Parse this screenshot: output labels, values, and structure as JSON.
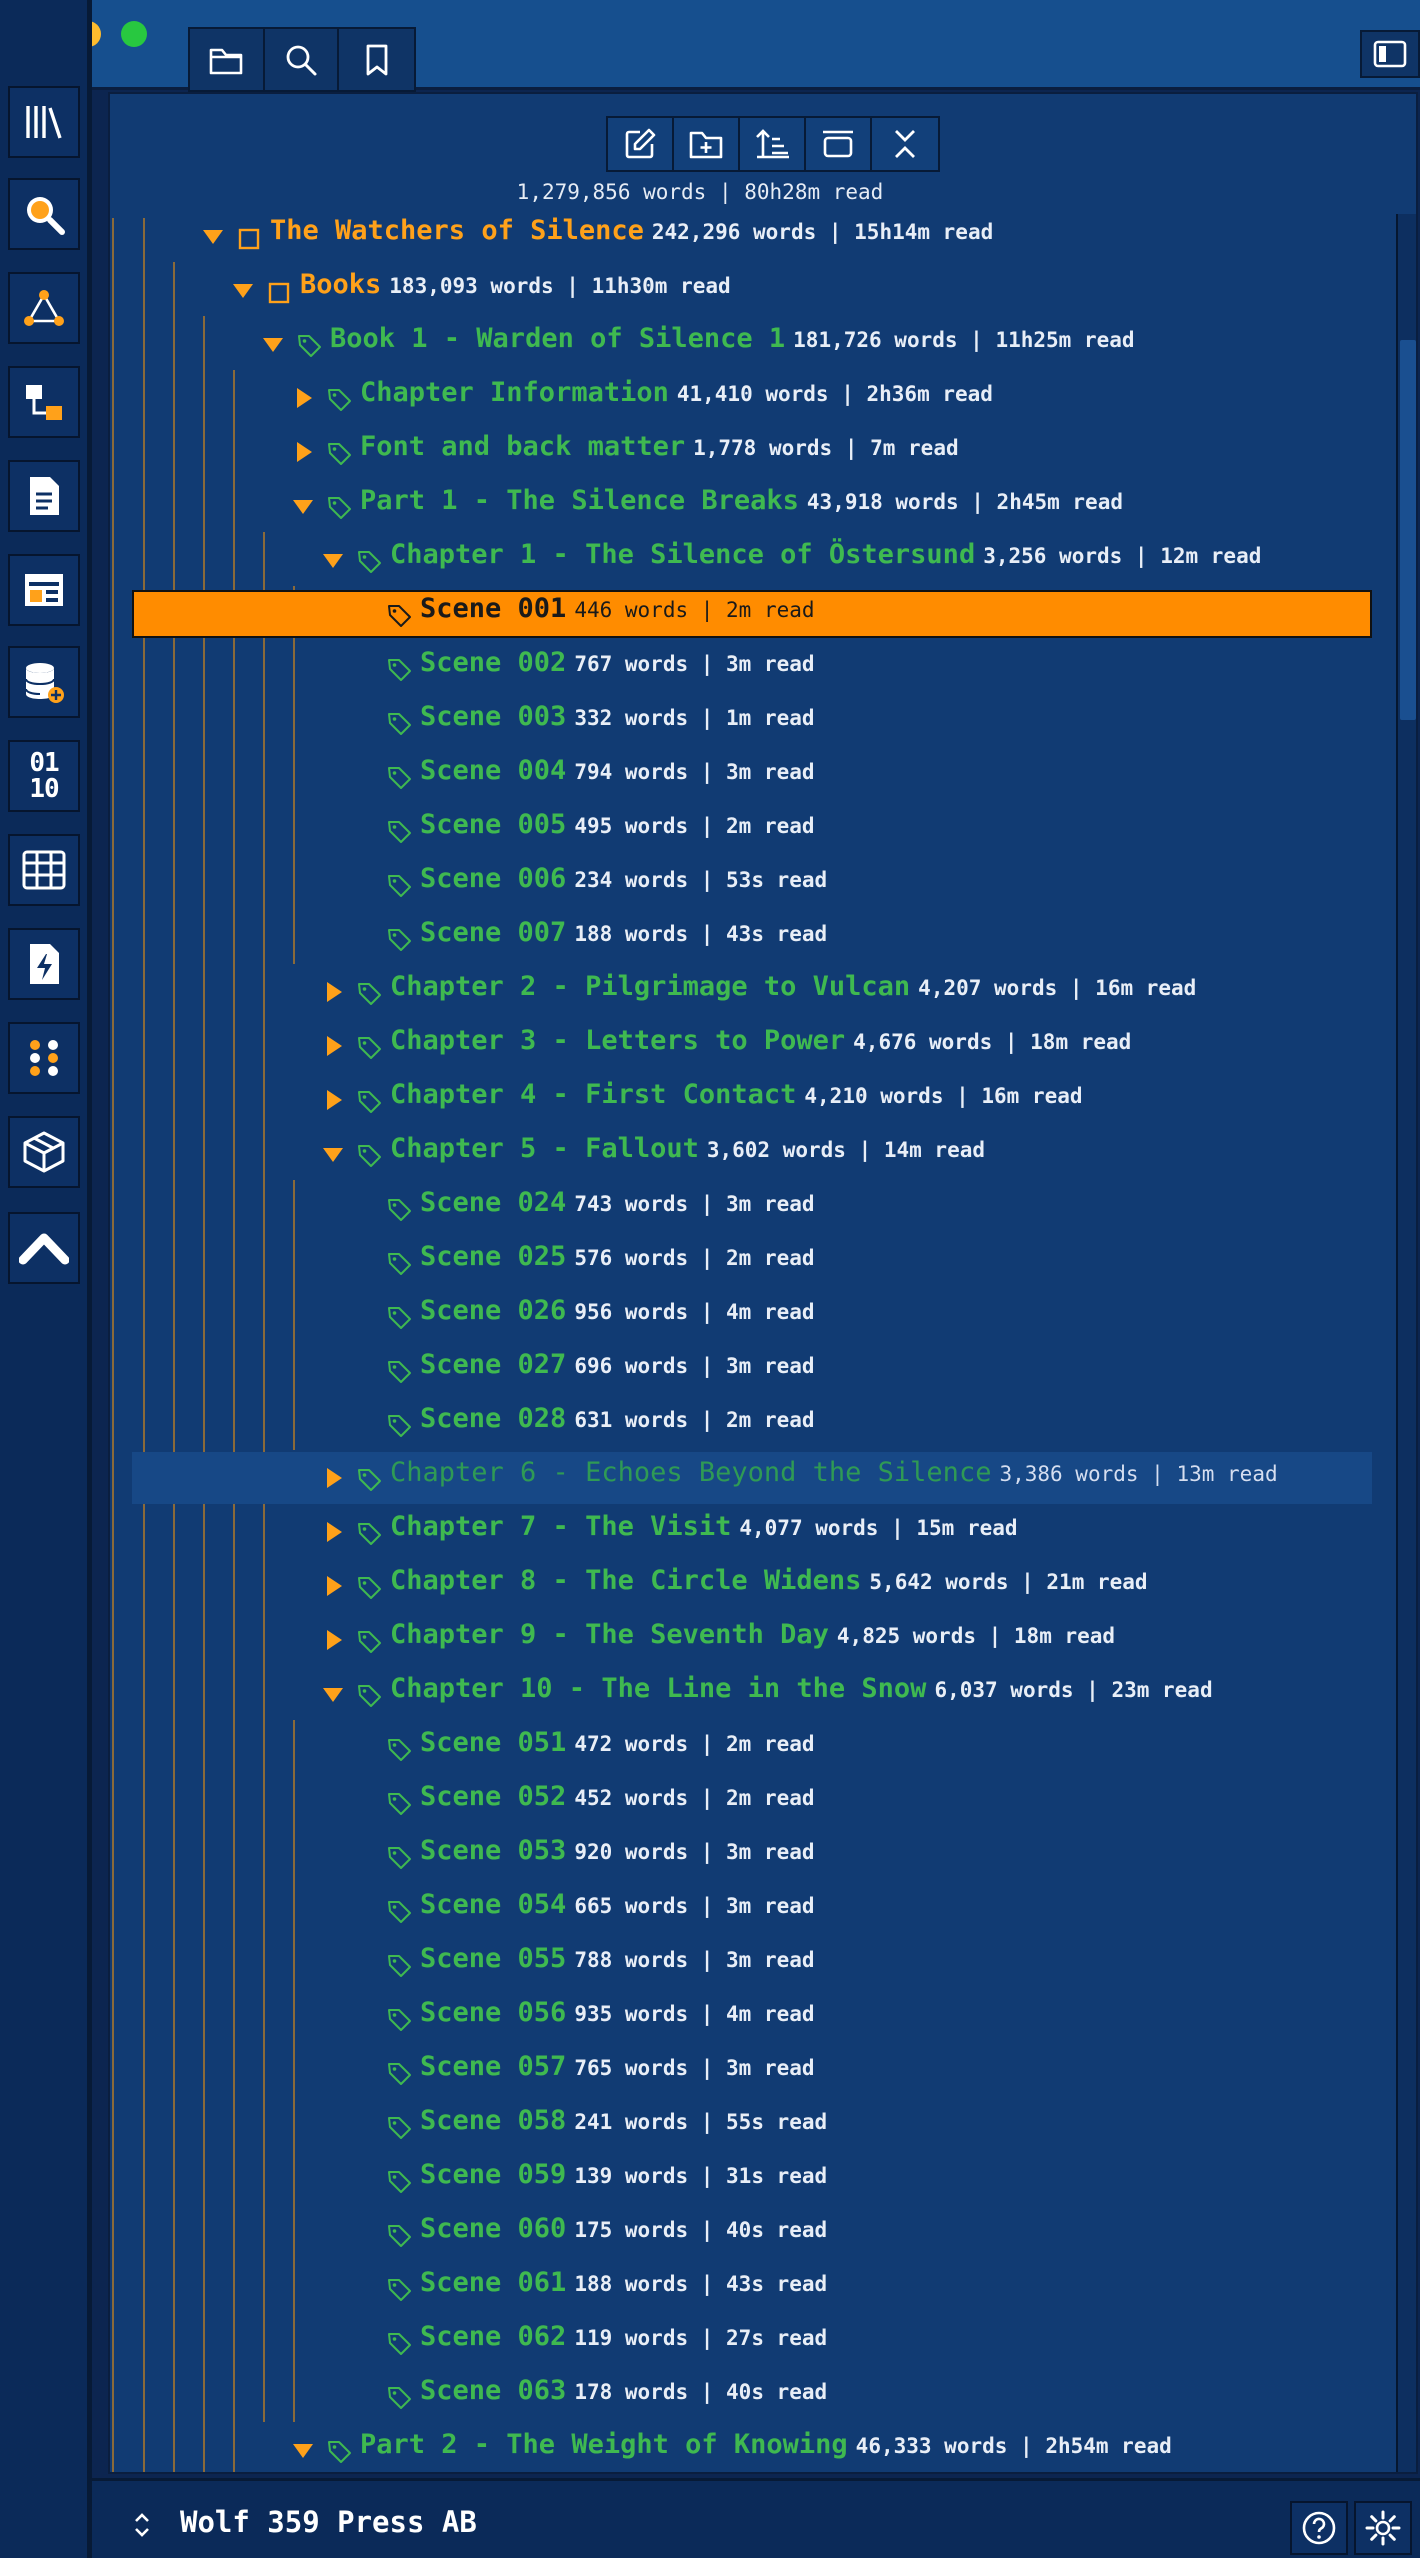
{
  "colors": {
    "accent": "#ff8c00",
    "folder_label": "#ffa11a",
    "doc_label": "#3fb950",
    "panel_bg": "#113b73",
    "guide_line": "#8a6a3a"
  },
  "top_toolbar": {
    "buttons": [
      {
        "icon": "folder-icon"
      },
      {
        "icon": "search-icon"
      },
      {
        "icon": "bookmark-icon"
      }
    ]
  },
  "activity_bar": {
    "items": [
      {
        "icon": "library-icon"
      },
      {
        "icon": "magnifier-icon"
      },
      {
        "icon": "graph-icon"
      },
      {
        "icon": "hierarchy-icon"
      },
      {
        "icon": "document-icon"
      },
      {
        "icon": "layout-icon"
      },
      {
        "icon": "database-add-icon"
      },
      {
        "icon": "binary-icon",
        "text": "01\n10"
      },
      {
        "icon": "table-icon"
      },
      {
        "icon": "file-bolt-icon"
      },
      {
        "icon": "nodes-icon"
      },
      {
        "icon": "cube-icon"
      },
      {
        "icon": "chevron-up-icon"
      }
    ]
  },
  "tree_toolbar": {
    "buttons": [
      {
        "icon": "edit-icon"
      },
      {
        "icon": "new-folder-icon"
      },
      {
        "icon": "sort-icon"
      },
      {
        "icon": "view-icon"
      },
      {
        "icon": "collapse-icon"
      }
    ]
  },
  "total_stats": "1,279,856 words | 80h28m read",
  "tree": [
    {
      "depth": 0,
      "toggle": "expanded",
      "icon": "folder",
      "label": "The Watchers of Silence",
      "stats": "242,296 words | 15h14m read",
      "color": "orange"
    },
    {
      "depth": 1,
      "toggle": "expanded",
      "icon": "folder",
      "label": "Books",
      "stats": "183,093 words | 11h30m read",
      "color": "orange"
    },
    {
      "depth": 2,
      "toggle": "expanded",
      "icon": "tag",
      "label": "Book 1 - Warden of Silence 1",
      "stats": "181,726 words | 11h25m read",
      "color": "green"
    },
    {
      "depth": 3,
      "toggle": "collapsed",
      "icon": "tag",
      "label": "Chapter Information",
      "stats": "41,410 words | 2h36m read",
      "color": "green"
    },
    {
      "depth": 3,
      "toggle": "collapsed",
      "icon": "tag",
      "label": "Font and back matter",
      "stats": "1,778 words | 7m read",
      "color": "green"
    },
    {
      "depth": 3,
      "toggle": "expanded",
      "icon": "tag",
      "label": "Part 1 - The Silence Breaks",
      "stats": "43,918 words | 2h45m read",
      "color": "green"
    },
    {
      "depth": 4,
      "toggle": "expanded",
      "icon": "tag",
      "label": "Chapter 1 - The Silence of Östersund",
      "stats": "3,256 words | 12m read",
      "color": "green"
    },
    {
      "depth": 5,
      "toggle": "none",
      "icon": "tag",
      "label": "Scene 001",
      "stats": "446 words | 2m read",
      "color": "green",
      "state": "selected"
    },
    {
      "depth": 5,
      "toggle": "none",
      "icon": "tag",
      "label": "Scene 002",
      "stats": "767 words | 3m read",
      "color": "green"
    },
    {
      "depth": 5,
      "toggle": "none",
      "icon": "tag",
      "label": "Scene 003",
      "stats": "332 words | 1m read",
      "color": "green"
    },
    {
      "depth": 5,
      "toggle": "none",
      "icon": "tag",
      "label": "Scene 004",
      "stats": "794 words | 3m read",
      "color": "green"
    },
    {
      "depth": 5,
      "toggle": "none",
      "icon": "tag",
      "label": "Scene 005",
      "stats": "495 words | 2m read",
      "color": "green"
    },
    {
      "depth": 5,
      "toggle": "none",
      "icon": "tag",
      "label": "Scene 006",
      "stats": "234 words | 53s read",
      "color": "green"
    },
    {
      "depth": 5,
      "toggle": "none",
      "icon": "tag",
      "label": "Scene 007",
      "stats": "188 words | 43s read",
      "color": "green"
    },
    {
      "depth": 4,
      "toggle": "collapsed",
      "icon": "tag",
      "label": "Chapter 2 - Pilgrimage to Vulcan",
      "stats": "4,207 words | 16m read",
      "color": "green"
    },
    {
      "depth": 4,
      "toggle": "collapsed",
      "icon": "tag",
      "label": "Chapter 3 - Letters to Power",
      "stats": "4,676 words | 18m read",
      "color": "green"
    },
    {
      "depth": 4,
      "toggle": "collapsed",
      "icon": "tag",
      "label": "Chapter 4 - First Contact",
      "stats": "4,210 words | 16m read",
      "color": "green"
    },
    {
      "depth": 4,
      "toggle": "expanded",
      "icon": "tag",
      "label": "Chapter 5 - Fallout",
      "stats": "3,602 words | 14m read",
      "color": "green"
    },
    {
      "depth": 5,
      "toggle": "none",
      "icon": "tag",
      "label": "Scene 024",
      "stats": "743 words | 3m read",
      "color": "green"
    },
    {
      "depth": 5,
      "toggle": "none",
      "icon": "tag",
      "label": "Scene 025",
      "stats": "576 words | 2m read",
      "color": "green"
    },
    {
      "depth": 5,
      "toggle": "none",
      "icon": "tag",
      "label": "Scene 026",
      "stats": "956 words | 4m read",
      "color": "green"
    },
    {
      "depth": 5,
      "toggle": "none",
      "icon": "tag",
      "label": "Scene 027",
      "stats": "696 words | 3m read",
      "color": "green"
    },
    {
      "depth": 5,
      "toggle": "none",
      "icon": "tag",
      "label": "Scene 028",
      "stats": "631 words | 2m read",
      "color": "green"
    },
    {
      "depth": 4,
      "toggle": "collapsed",
      "icon": "tag",
      "label": "Chapter 6 - Echoes Beyond the Silence",
      "stats": "3,386 words | 13m read",
      "color": "green",
      "state": "hover"
    },
    {
      "depth": 4,
      "toggle": "collapsed",
      "icon": "tag",
      "label": "Chapter 7 - The Visit",
      "stats": "4,077 words | 15m read",
      "color": "green"
    },
    {
      "depth": 4,
      "toggle": "collapsed",
      "icon": "tag",
      "label": "Chapter 8 - The Circle Widens",
      "stats": "5,642 words | 21m read",
      "color": "green"
    },
    {
      "depth": 4,
      "toggle": "collapsed",
      "icon": "tag",
      "label": "Chapter 9 - The Seventh Day",
      "stats": "4,825 words | 18m read",
      "color": "green"
    },
    {
      "depth": 4,
      "toggle": "expanded",
      "icon": "tag",
      "label": "Chapter 10 - The Line in the Snow",
      "stats": "6,037 words | 23m read",
      "color": "green"
    },
    {
      "depth": 5,
      "toggle": "none",
      "icon": "tag",
      "label": "Scene 051",
      "stats": "472 words | 2m read",
      "color": "green"
    },
    {
      "depth": 5,
      "toggle": "none",
      "icon": "tag",
      "label": "Scene 052",
      "stats": "452 words | 2m read",
      "color": "green"
    },
    {
      "depth": 5,
      "toggle": "none",
      "icon": "tag",
      "label": "Scene 053",
      "stats": "920 words | 3m read",
      "color": "green"
    },
    {
      "depth": 5,
      "toggle": "none",
      "icon": "tag",
      "label": "Scene 054",
      "stats": "665 words | 3m read",
      "color": "green"
    },
    {
      "depth": 5,
      "toggle": "none",
      "icon": "tag",
      "label": "Scene 055",
      "stats": "788 words | 3m read",
      "color": "green"
    },
    {
      "depth": 5,
      "toggle": "none",
      "icon": "tag",
      "label": "Scene 056",
      "stats": "935 words | 4m read",
      "color": "green"
    },
    {
      "depth": 5,
      "toggle": "none",
      "icon": "tag",
      "label": "Scene 057",
      "stats": "765 words | 3m read",
      "color": "green"
    },
    {
      "depth": 5,
      "toggle": "none",
      "icon": "tag",
      "label": "Scene 058",
      "stats": "241 words | 55s read",
      "color": "green"
    },
    {
      "depth": 5,
      "toggle": "none",
      "icon": "tag",
      "label": "Scene 059",
      "stats": "139 words | 31s read",
      "color": "green"
    },
    {
      "depth": 5,
      "toggle": "none",
      "icon": "tag",
      "label": "Scene 060",
      "stats": "175 words | 40s read",
      "color": "green"
    },
    {
      "depth": 5,
      "toggle": "none",
      "icon": "tag",
      "label": "Scene 061",
      "stats": "188 words | 43s read",
      "color": "green"
    },
    {
      "depth": 5,
      "toggle": "none",
      "icon": "tag",
      "label": "Scene 062",
      "stats": "119 words | 27s read",
      "color": "green"
    },
    {
      "depth": 5,
      "toggle": "none",
      "icon": "tag",
      "label": "Scene 063",
      "stats": "178 words | 40s read",
      "color": "green"
    },
    {
      "depth": 3,
      "toggle": "expanded",
      "icon": "tag",
      "label": "Part 2 - The Weight of Knowing",
      "stats": "46,333 words | 2h54m read",
      "color": "green"
    }
  ],
  "status_bar": {
    "org_name": "Wolf 359 Press AB",
    "buttons": [
      {
        "icon": "help-icon"
      },
      {
        "icon": "settings-icon"
      }
    ]
  }
}
